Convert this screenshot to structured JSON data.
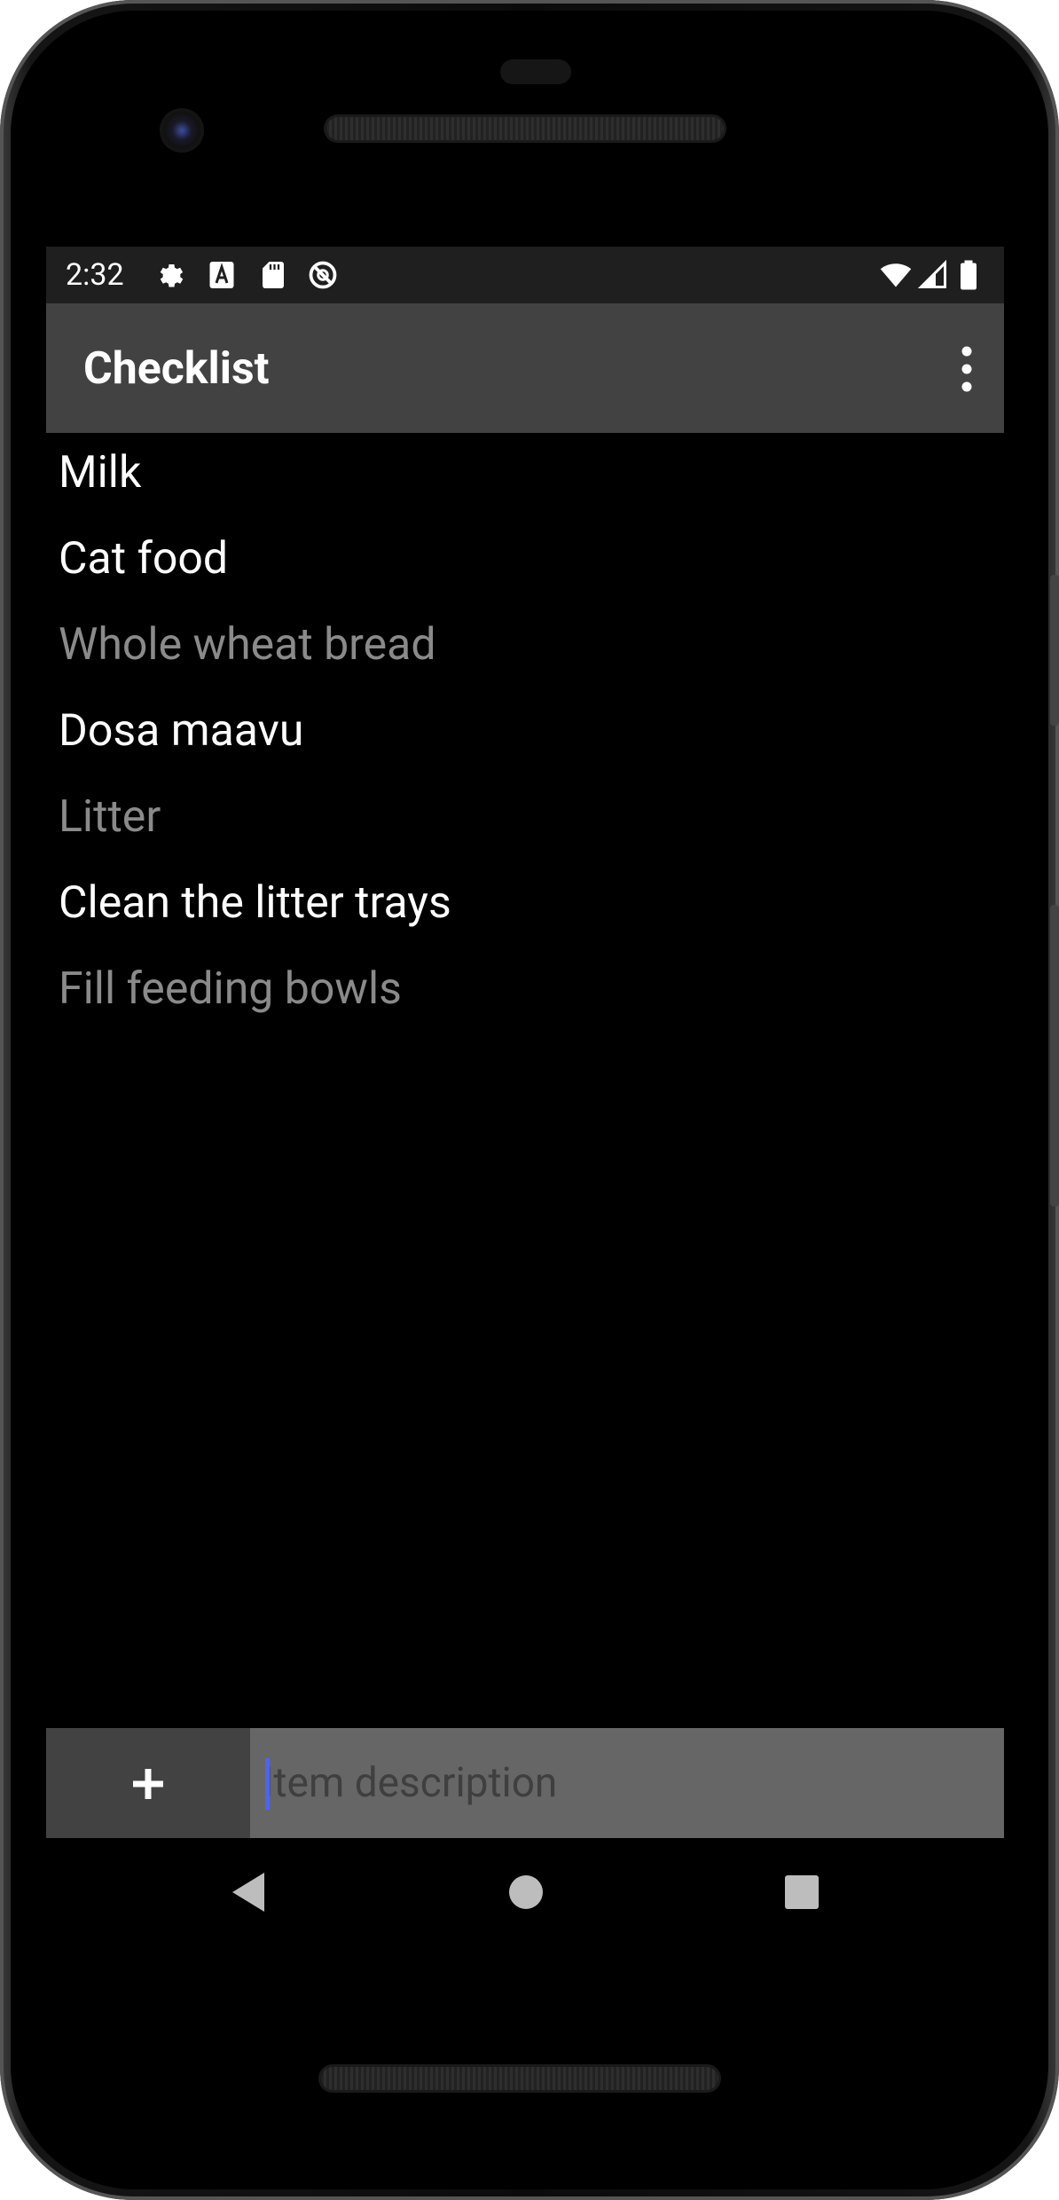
{
  "status_bar": {
    "time": "2:32",
    "left_icons": [
      "gear-icon",
      "a-letter-icon",
      "sd-card-icon",
      "no-data-icon"
    ],
    "right_icons": [
      "wifi-icon",
      "cell-signal-icon",
      "battery-icon"
    ]
  },
  "toolbar": {
    "title": "Checklist",
    "menu_icon": "overflow-menu-icon"
  },
  "checklist": {
    "items": [
      {
        "label": "Milk",
        "checked": false
      },
      {
        "label": "Cat food",
        "checked": false
      },
      {
        "label": "Whole wheat bread",
        "checked": true
      },
      {
        "label": "Dosa maavu",
        "checked": false
      },
      {
        "label": "Litter",
        "checked": true
      },
      {
        "label": "Clean the litter trays",
        "checked": false
      },
      {
        "label": "Fill feeding bowls",
        "checked": true
      }
    ]
  },
  "bottom_bar": {
    "add_label": "+",
    "input_placeholder": "Item description",
    "input_value": ""
  },
  "nav_bar": {
    "buttons": [
      "back-icon",
      "home-icon",
      "recents-icon"
    ]
  },
  "colors": {
    "toolbar_bg": "#424242",
    "item_text": "#ffffff",
    "checked_item_text": "#8a8a8a",
    "input_bg": "#666666",
    "add_button_bg": "#424242",
    "cursor": "#4a63ff"
  }
}
